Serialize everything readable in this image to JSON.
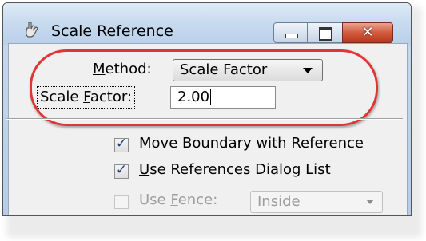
{
  "window": {
    "title": "Scale Reference",
    "close_glyph": "✕"
  },
  "icons": {
    "app": "hand-pointer-icon",
    "minimize": "minimize-icon",
    "maximize": "maximize-icon",
    "close": "close-icon",
    "checkmark": "checkmark-icon",
    "dropdown": "chevron-down-icon"
  },
  "method": {
    "label_pre": "",
    "label_ul": "M",
    "label_post": "ethod:",
    "value": "Scale Factor"
  },
  "scale_factor": {
    "label_pre": "Scale ",
    "label_ul": "F",
    "label_post": "actor:",
    "value": "2.00"
  },
  "options": {
    "move_boundary": {
      "label": "Move Boundary with Reference",
      "checked": true,
      "enabled": true
    },
    "use_references": {
      "label_ul": "U",
      "label_post": "se References Dialog List",
      "checked": true,
      "enabled": true
    },
    "use_fence": {
      "label_pre": "Use ",
      "label_ul": "F",
      "label_post": "ence:",
      "checked": false,
      "enabled": false,
      "mode": "Inside"
    }
  },
  "checkmark_glyph": "✓",
  "colors": {
    "highlight_oval": "#e03535",
    "close_button": "#c9452a",
    "titlebar": "#c8dbef"
  }
}
